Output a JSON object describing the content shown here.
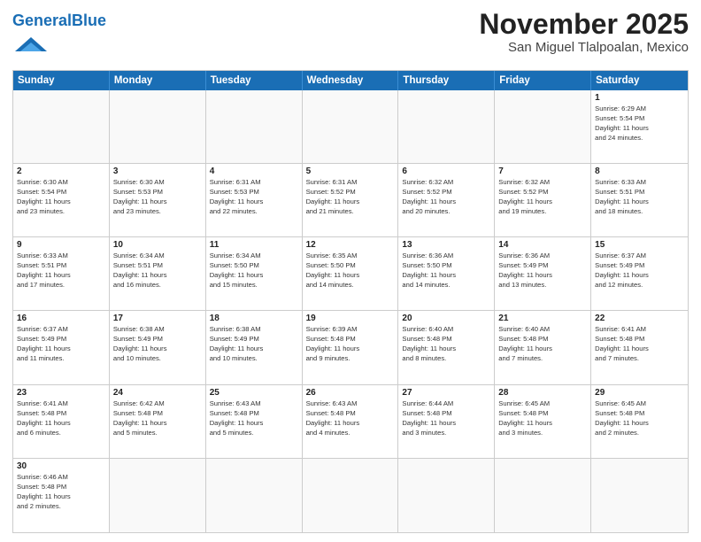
{
  "header": {
    "logo_general": "General",
    "logo_blue": "Blue",
    "month_title": "November 2025",
    "location": "San Miguel Tlalpoalan, Mexico"
  },
  "weekdays": [
    "Sunday",
    "Monday",
    "Tuesday",
    "Wednesday",
    "Thursday",
    "Friday",
    "Saturday"
  ],
  "weeks": [
    [
      {
        "day": "",
        "info": "",
        "empty": true
      },
      {
        "day": "",
        "info": "",
        "empty": true
      },
      {
        "day": "",
        "info": "",
        "empty": true
      },
      {
        "day": "",
        "info": "",
        "empty": true
      },
      {
        "day": "",
        "info": "",
        "empty": true
      },
      {
        "day": "",
        "info": "",
        "empty": true
      },
      {
        "day": "1",
        "info": "Sunrise: 6:29 AM\nSunset: 5:54 PM\nDaylight: 11 hours\nand 24 minutes.",
        "empty": false
      }
    ],
    [
      {
        "day": "2",
        "info": "Sunrise: 6:30 AM\nSunset: 5:54 PM\nDaylight: 11 hours\nand 23 minutes.",
        "empty": false
      },
      {
        "day": "3",
        "info": "Sunrise: 6:30 AM\nSunset: 5:53 PM\nDaylight: 11 hours\nand 23 minutes.",
        "empty": false
      },
      {
        "day": "4",
        "info": "Sunrise: 6:31 AM\nSunset: 5:53 PM\nDaylight: 11 hours\nand 22 minutes.",
        "empty": false
      },
      {
        "day": "5",
        "info": "Sunrise: 6:31 AM\nSunset: 5:52 PM\nDaylight: 11 hours\nand 21 minutes.",
        "empty": false
      },
      {
        "day": "6",
        "info": "Sunrise: 6:32 AM\nSunset: 5:52 PM\nDaylight: 11 hours\nand 20 minutes.",
        "empty": false
      },
      {
        "day": "7",
        "info": "Sunrise: 6:32 AM\nSunset: 5:52 PM\nDaylight: 11 hours\nand 19 minutes.",
        "empty": false
      },
      {
        "day": "8",
        "info": "Sunrise: 6:33 AM\nSunset: 5:51 PM\nDaylight: 11 hours\nand 18 minutes.",
        "empty": false
      }
    ],
    [
      {
        "day": "9",
        "info": "Sunrise: 6:33 AM\nSunset: 5:51 PM\nDaylight: 11 hours\nand 17 minutes.",
        "empty": false
      },
      {
        "day": "10",
        "info": "Sunrise: 6:34 AM\nSunset: 5:51 PM\nDaylight: 11 hours\nand 16 minutes.",
        "empty": false
      },
      {
        "day": "11",
        "info": "Sunrise: 6:34 AM\nSunset: 5:50 PM\nDaylight: 11 hours\nand 15 minutes.",
        "empty": false
      },
      {
        "day": "12",
        "info": "Sunrise: 6:35 AM\nSunset: 5:50 PM\nDaylight: 11 hours\nand 14 minutes.",
        "empty": false
      },
      {
        "day": "13",
        "info": "Sunrise: 6:36 AM\nSunset: 5:50 PM\nDaylight: 11 hours\nand 14 minutes.",
        "empty": false
      },
      {
        "day": "14",
        "info": "Sunrise: 6:36 AM\nSunset: 5:49 PM\nDaylight: 11 hours\nand 13 minutes.",
        "empty": false
      },
      {
        "day": "15",
        "info": "Sunrise: 6:37 AM\nSunset: 5:49 PM\nDaylight: 11 hours\nand 12 minutes.",
        "empty": false
      }
    ],
    [
      {
        "day": "16",
        "info": "Sunrise: 6:37 AM\nSunset: 5:49 PM\nDaylight: 11 hours\nand 11 minutes.",
        "empty": false
      },
      {
        "day": "17",
        "info": "Sunrise: 6:38 AM\nSunset: 5:49 PM\nDaylight: 11 hours\nand 10 minutes.",
        "empty": false
      },
      {
        "day": "18",
        "info": "Sunrise: 6:38 AM\nSunset: 5:49 PM\nDaylight: 11 hours\nand 10 minutes.",
        "empty": false
      },
      {
        "day": "19",
        "info": "Sunrise: 6:39 AM\nSunset: 5:48 PM\nDaylight: 11 hours\nand 9 minutes.",
        "empty": false
      },
      {
        "day": "20",
        "info": "Sunrise: 6:40 AM\nSunset: 5:48 PM\nDaylight: 11 hours\nand 8 minutes.",
        "empty": false
      },
      {
        "day": "21",
        "info": "Sunrise: 6:40 AM\nSunset: 5:48 PM\nDaylight: 11 hours\nand 7 minutes.",
        "empty": false
      },
      {
        "day": "22",
        "info": "Sunrise: 6:41 AM\nSunset: 5:48 PM\nDaylight: 11 hours\nand 7 minutes.",
        "empty": false
      }
    ],
    [
      {
        "day": "23",
        "info": "Sunrise: 6:41 AM\nSunset: 5:48 PM\nDaylight: 11 hours\nand 6 minutes.",
        "empty": false
      },
      {
        "day": "24",
        "info": "Sunrise: 6:42 AM\nSunset: 5:48 PM\nDaylight: 11 hours\nand 5 minutes.",
        "empty": false
      },
      {
        "day": "25",
        "info": "Sunrise: 6:43 AM\nSunset: 5:48 PM\nDaylight: 11 hours\nand 5 minutes.",
        "empty": false
      },
      {
        "day": "26",
        "info": "Sunrise: 6:43 AM\nSunset: 5:48 PM\nDaylight: 11 hours\nand 4 minutes.",
        "empty": false
      },
      {
        "day": "27",
        "info": "Sunrise: 6:44 AM\nSunset: 5:48 PM\nDaylight: 11 hours\nand 3 minutes.",
        "empty": false
      },
      {
        "day": "28",
        "info": "Sunrise: 6:45 AM\nSunset: 5:48 PM\nDaylight: 11 hours\nand 3 minutes.",
        "empty": false
      },
      {
        "day": "29",
        "info": "Sunrise: 6:45 AM\nSunset: 5:48 PM\nDaylight: 11 hours\nand 2 minutes.",
        "empty": false
      }
    ],
    [
      {
        "day": "30",
        "info": "Sunrise: 6:46 AM\nSunset: 5:48 PM\nDaylight: 11 hours\nand 2 minutes.",
        "empty": false
      },
      {
        "day": "",
        "info": "",
        "empty": true
      },
      {
        "day": "",
        "info": "",
        "empty": true
      },
      {
        "day": "",
        "info": "",
        "empty": true
      },
      {
        "day": "",
        "info": "",
        "empty": true
      },
      {
        "day": "",
        "info": "",
        "empty": true
      },
      {
        "day": "",
        "info": "",
        "empty": true
      }
    ]
  ]
}
